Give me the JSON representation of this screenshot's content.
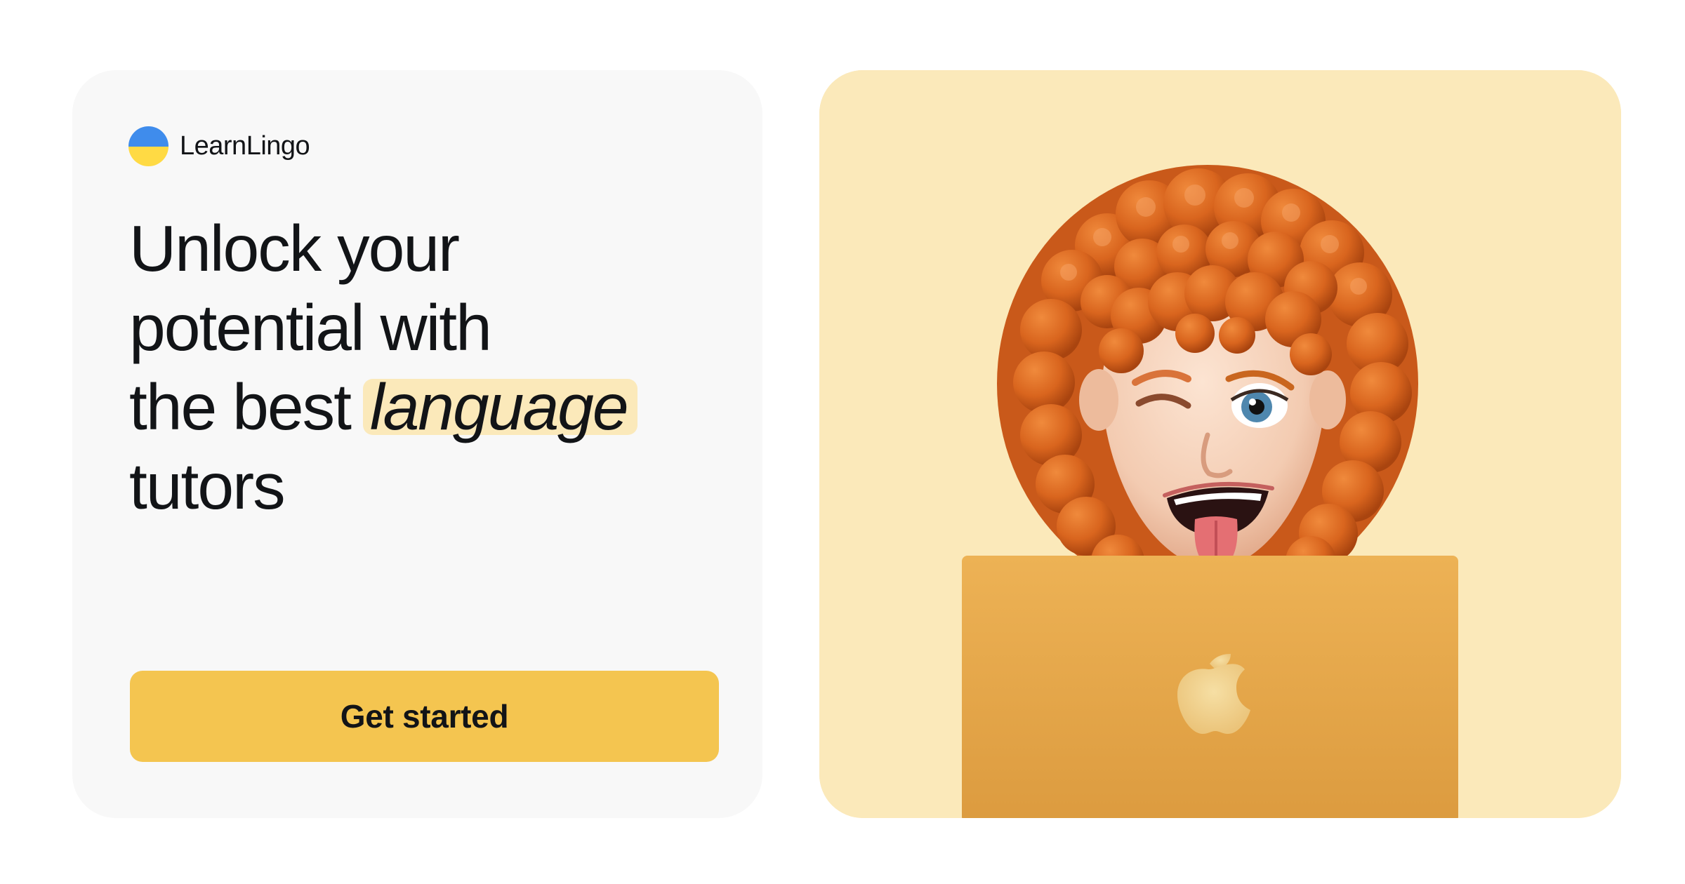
{
  "brand": {
    "name": "LearnLingo",
    "logo_colors": {
      "top": "#3F8CEC",
      "bottom": "#FFDA44"
    }
  },
  "hero": {
    "headline_lines": [
      "Unlock your",
      "potential with",
      "the best"
    ],
    "headline_highlight": "language",
    "headline_last": "tutors",
    "cta_label": "Get started"
  },
  "colors": {
    "accent": "#F4C550",
    "highlight_bg": "#FBE9BA",
    "image_bg": "#FBE9BA",
    "laptop": "#E8A94B"
  },
  "illustration": {
    "subject": "memoji-girl-with-laptop",
    "laptop_logo_icon": "apple-logo-icon"
  }
}
